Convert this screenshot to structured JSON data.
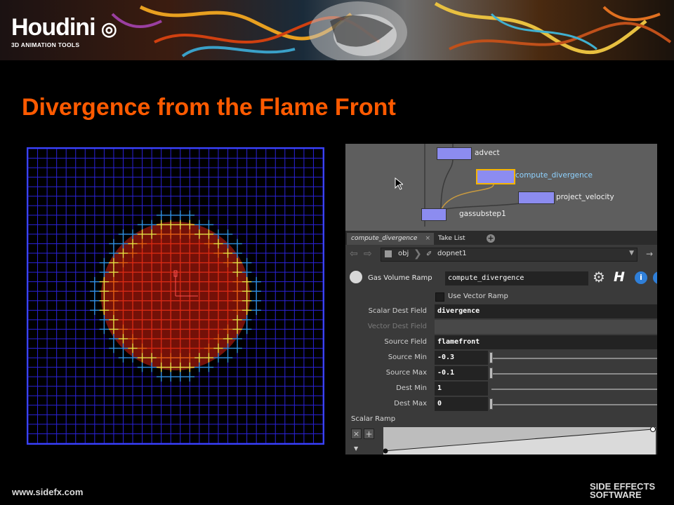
{
  "logo": {
    "name": "Houdini",
    "tagline": "3D ANIMATION TOOLS"
  },
  "slide": {
    "title": "Divergence from the Flame Front"
  },
  "network": {
    "nodes": [
      {
        "label": "advect"
      },
      {
        "label": "compute_divergence"
      },
      {
        "label": "project_velocity"
      },
      {
        "label": "gassubstep1"
      }
    ]
  },
  "tabs": [
    {
      "label": "compute_divergence"
    },
    {
      "label": "Take List"
    }
  ],
  "path": {
    "root": "obj",
    "network": "dopnet1"
  },
  "node_header": {
    "type": "Gas Volume Ramp",
    "name": "compute_divergence"
  },
  "parms": {
    "use_vector_ramp": "Use Vector Ramp",
    "scalar_dest": {
      "label": "Scalar Dest Field",
      "value": "divergence"
    },
    "vector_dest": {
      "label": "Vector Dest Field",
      "value": ""
    },
    "source": {
      "label": "Source Field",
      "value": "flamefront"
    },
    "source_min": {
      "label": "Source Min",
      "value": "-0.3"
    },
    "source_max": {
      "label": "Source Max",
      "value": "-0.1"
    },
    "dest_min": {
      "label": "Dest Min",
      "value": "1"
    },
    "dest_max": {
      "label": "Dest Max",
      "value": "0"
    },
    "ramp_label": "Scalar Ramp"
  },
  "footer": {
    "url": "www.sidefx.com",
    "brand_line1": "SIDE EFFECTS",
    "brand_line2": "SOFTWARE"
  },
  "colors": {
    "title": "#ff5a00",
    "grid": "#2b22d8",
    "node_body": "#8c8cf0",
    "selected_node": "#f5b400",
    "selected_label": "#8fd2ff"
  }
}
